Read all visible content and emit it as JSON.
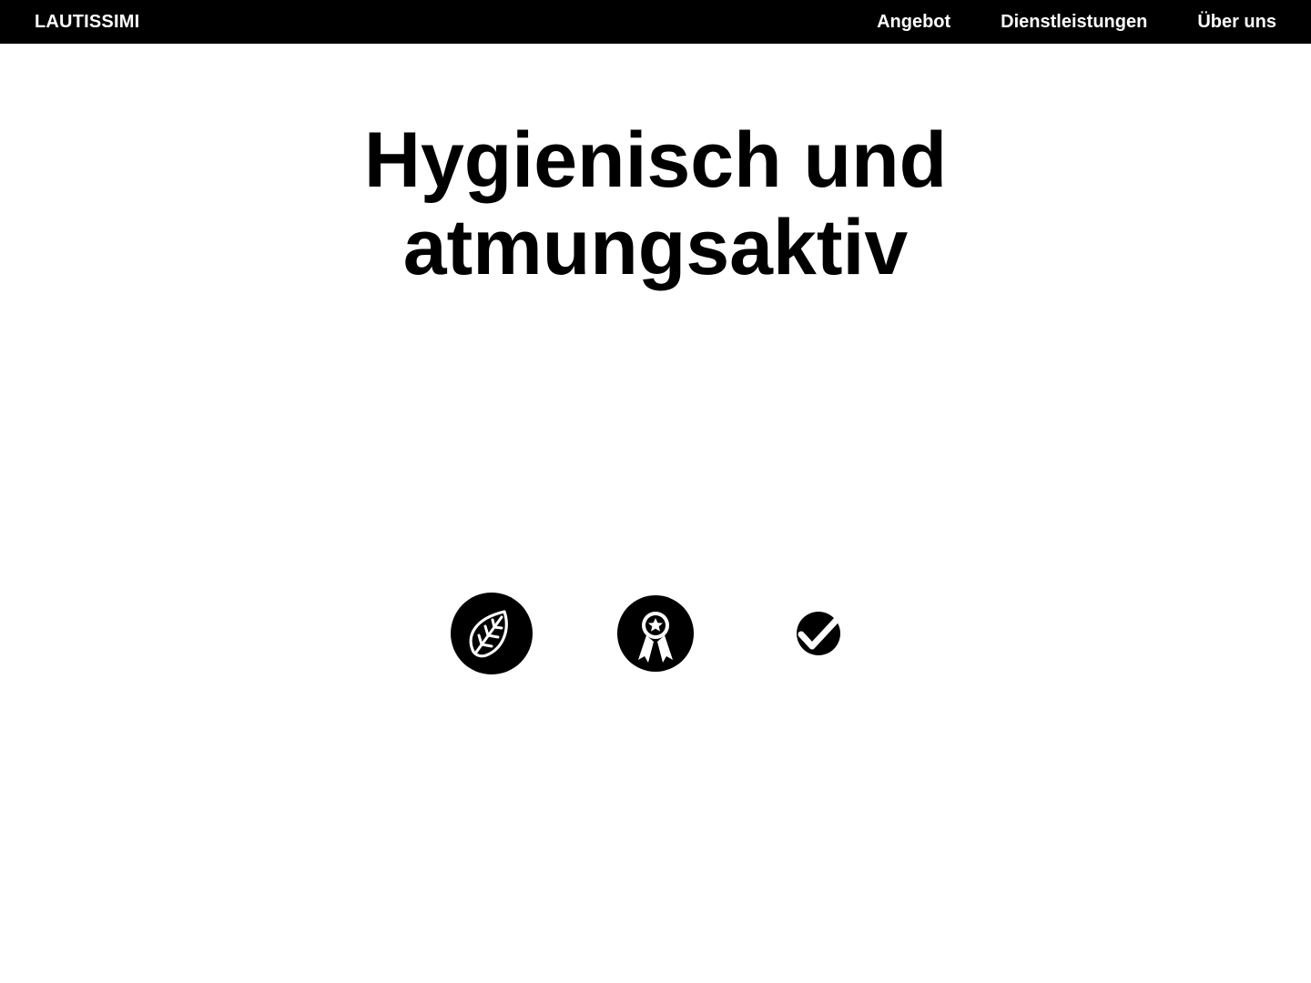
{
  "nav": {
    "brand": "LAUTISSIMI",
    "links": [
      {
        "label": "Angebot"
      },
      {
        "label": "Dienstleistungen"
      },
      {
        "label": "Über uns"
      }
    ]
  },
  "hero": {
    "title_line1": "Hygienisch und",
    "title_line2": "atmungsaktiv"
  },
  "features": {
    "icons": [
      "leaf-icon",
      "award-ribbon-icon",
      "checkmark-icon"
    ]
  },
  "colors": {
    "background": "#ffffff",
    "navbar": "#000000",
    "text": "#000000",
    "nav_text": "#ffffff"
  }
}
